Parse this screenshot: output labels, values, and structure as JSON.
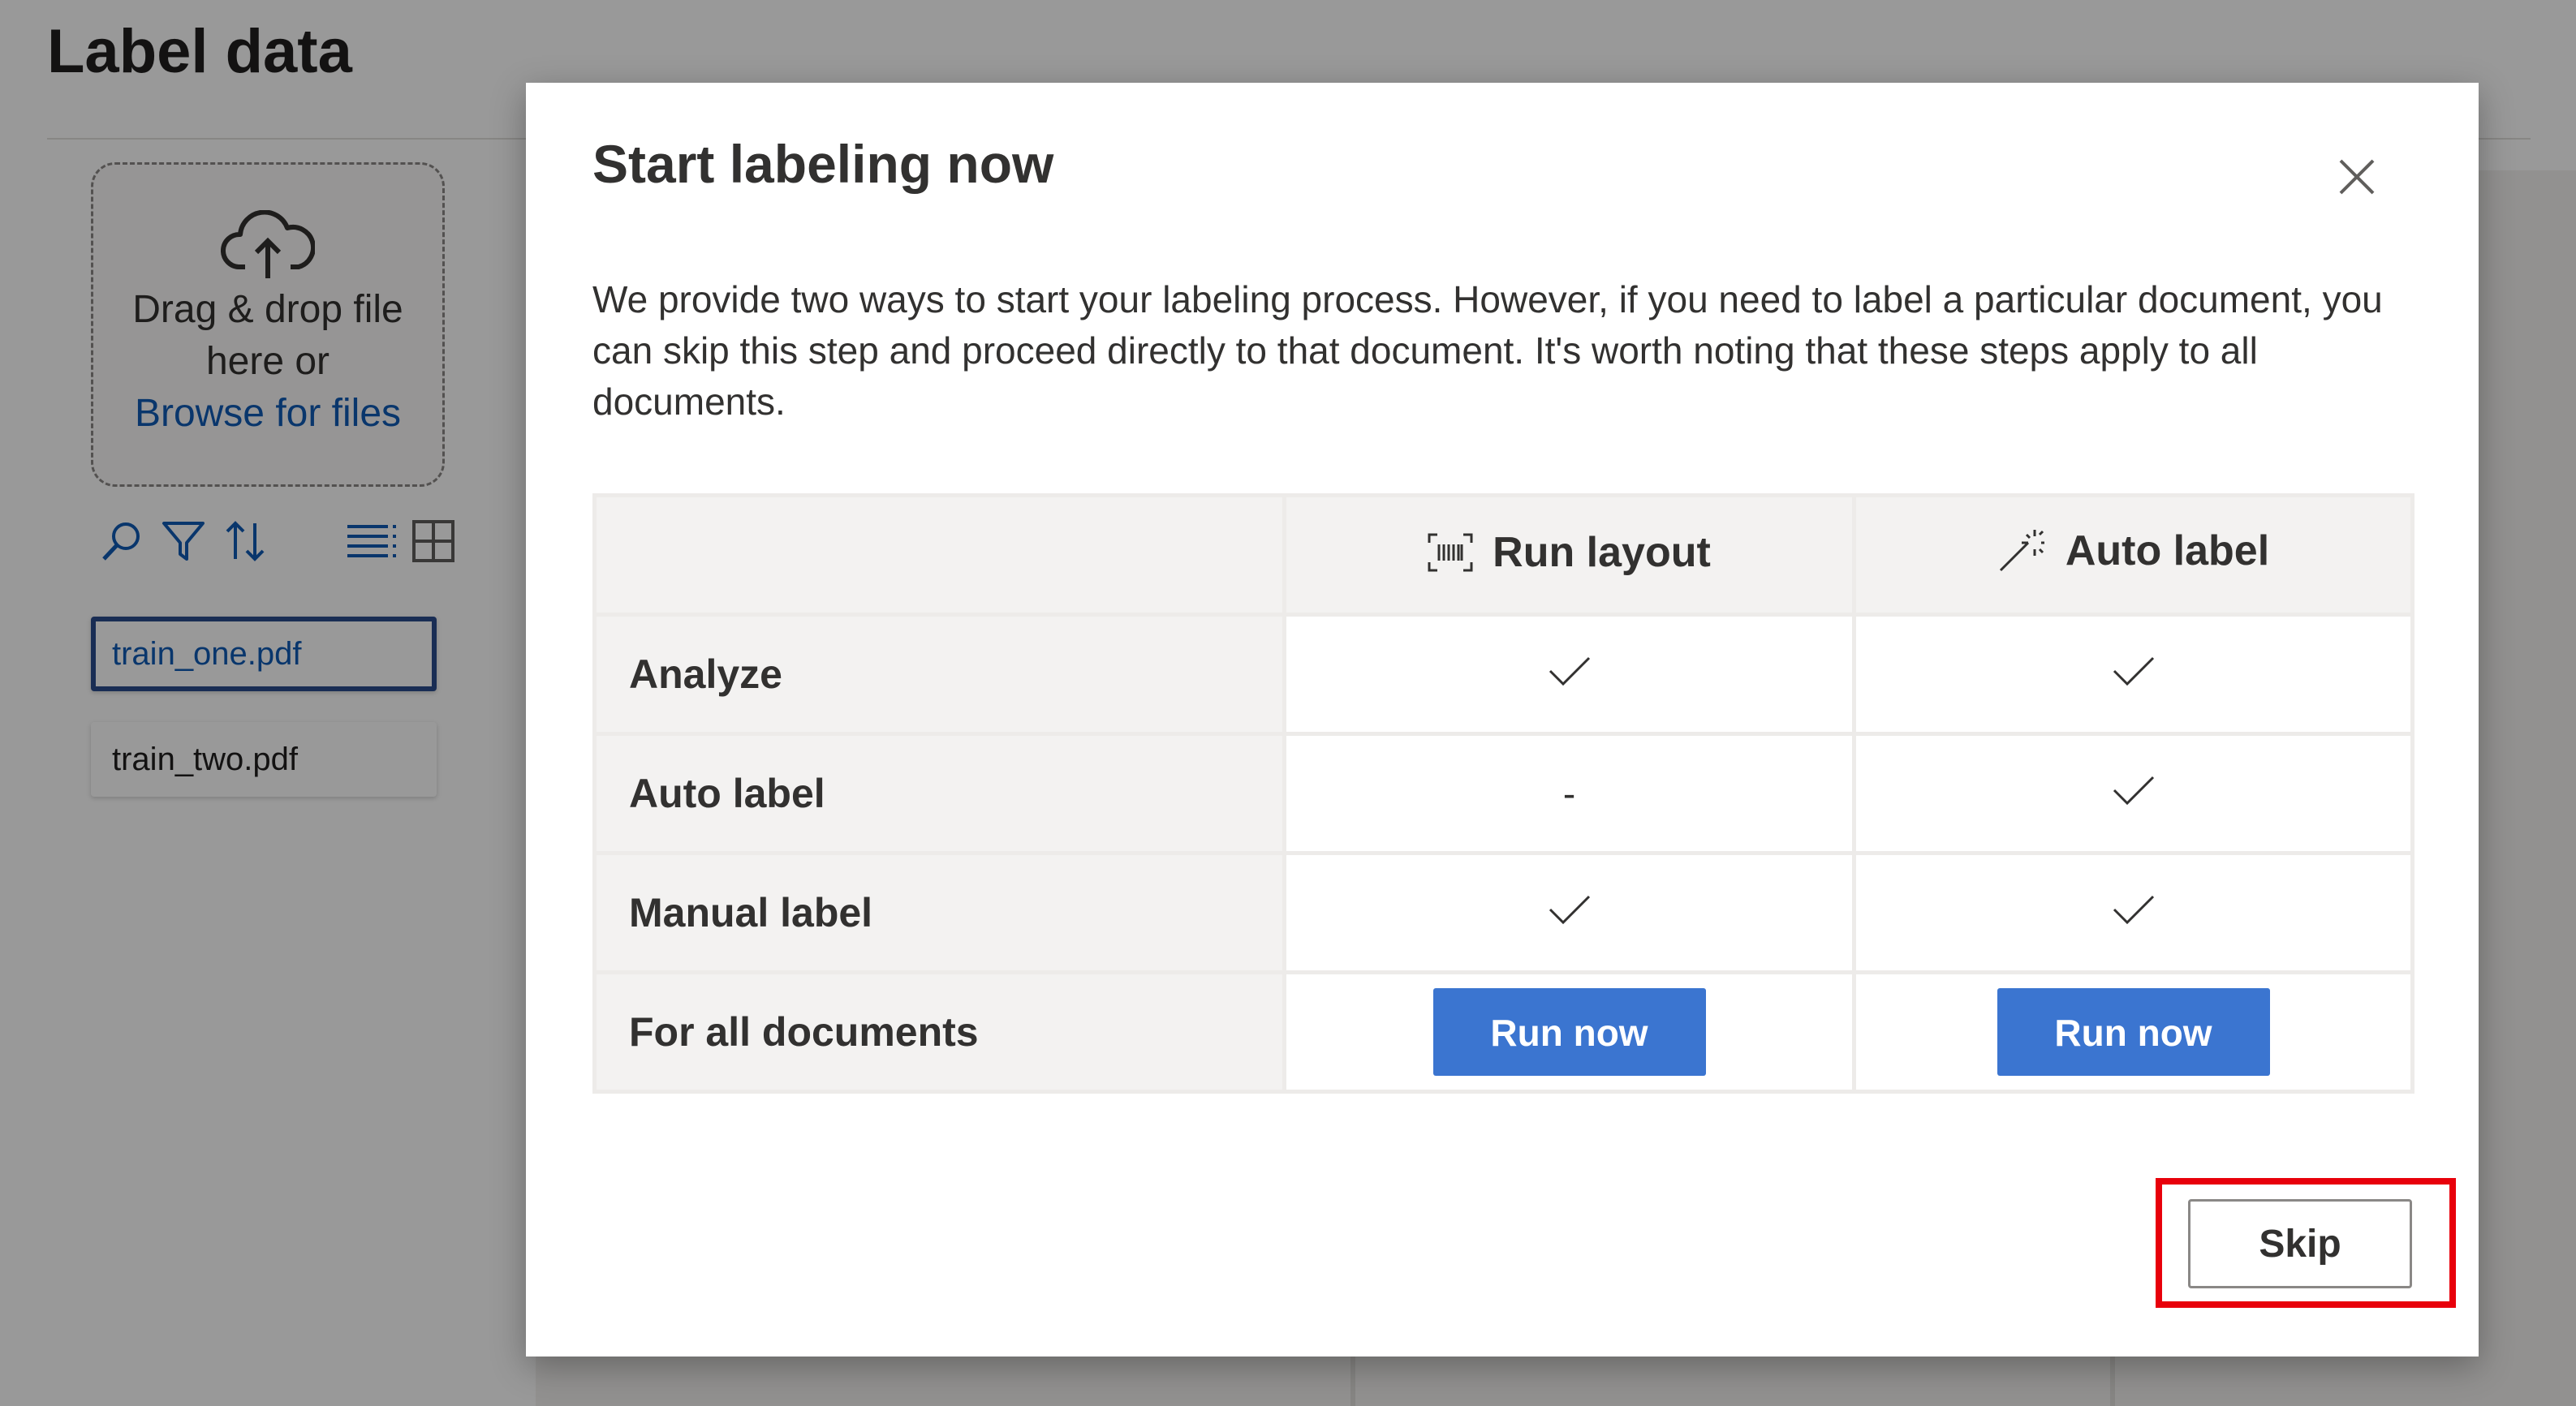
{
  "page": {
    "title": "Label data"
  },
  "upload": {
    "icon": "cloud-upload-icon",
    "line1": "Drag & drop file",
    "line2": "here or",
    "browse_link": "Browse for files"
  },
  "toolbar": {
    "icons": [
      "search-icon",
      "filter-icon",
      "sort-icon",
      "list-view-icon",
      "grid-view-icon"
    ]
  },
  "files": [
    {
      "name": "train_one.pdf",
      "selected": true
    },
    {
      "name": "train_two.pdf",
      "selected": false
    }
  ],
  "modal": {
    "title": "Start labeling now",
    "description": "We provide two ways to start your labeling process. However, if you need to label a particular document, you can skip this step and proceed directly to that document. It's worth noting that these steps apply to all documents.",
    "columns": [
      {
        "label": "Run layout",
        "icon": "scan-layout-icon"
      },
      {
        "label": "Auto label",
        "icon": "magic-wand-icon"
      }
    ],
    "rows": [
      {
        "label": "Analyze",
        "run_layout": "check",
        "auto_label": "check"
      },
      {
        "label": "Auto label",
        "run_layout": "-",
        "auto_label": "check"
      },
      {
        "label": "Manual label",
        "run_layout": "check",
        "auto_label": "check"
      },
      {
        "label": "For all documents",
        "run_layout": "Run now",
        "auto_label": "Run now"
      }
    ],
    "skip_label": "Skip"
  },
  "colors": {
    "primary_button": "#3b75d0",
    "highlight_box": "#e8000b",
    "link": "#0f5bb5"
  }
}
